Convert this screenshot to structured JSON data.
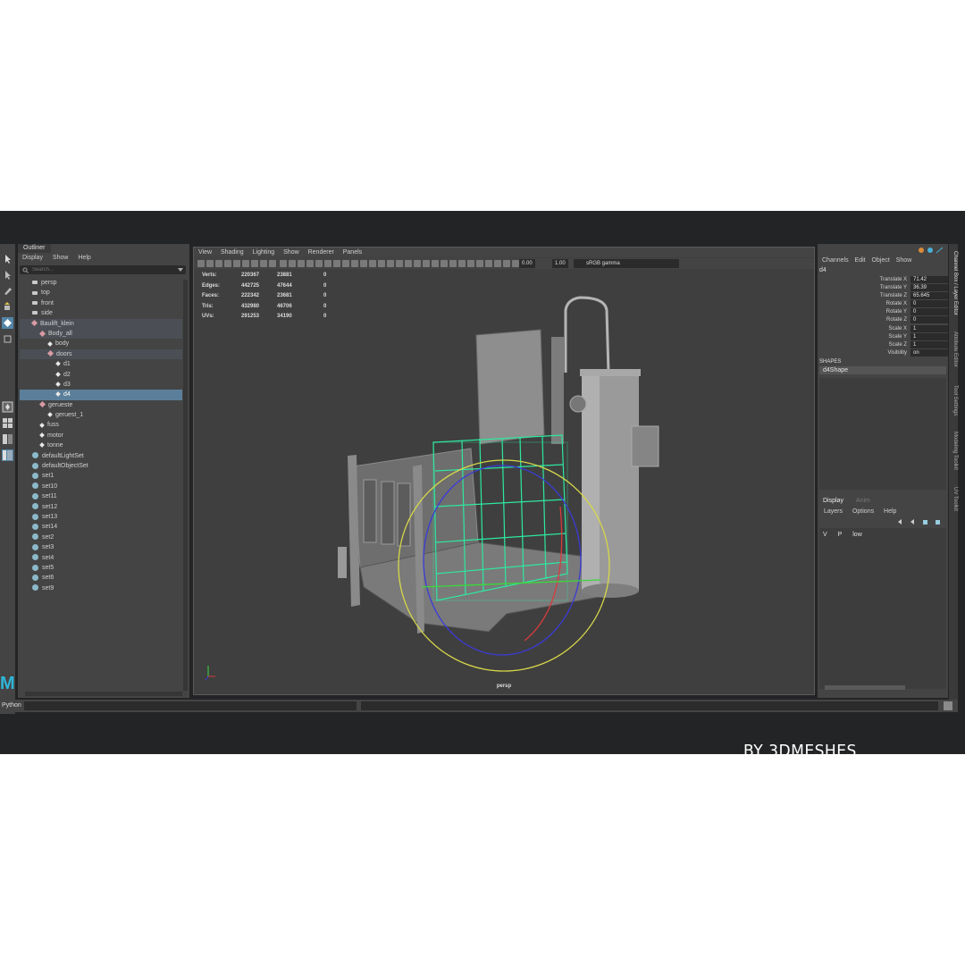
{
  "outliner": {
    "tab": "Outliner",
    "menu": [
      "Display",
      "Show",
      "Help"
    ],
    "search_placeholder": "Search...",
    "items": [
      {
        "label": "persp",
        "indent": 0,
        "type": "cam"
      },
      {
        "label": "top",
        "indent": 0,
        "type": "cam"
      },
      {
        "label": "front",
        "indent": 0,
        "type": "cam"
      },
      {
        "label": "side",
        "indent": 0,
        "type": "cam"
      },
      {
        "label": "Baulift_klein",
        "indent": 0,
        "type": "grp",
        "state": "hl"
      },
      {
        "label": "Body_all",
        "indent": 1,
        "type": "grp",
        "state": "hl"
      },
      {
        "label": "body",
        "indent": 2,
        "type": "mesh"
      },
      {
        "label": "doors",
        "indent": 2,
        "type": "grp",
        "state": "hl"
      },
      {
        "label": "d1",
        "indent": 3,
        "type": "mesh"
      },
      {
        "label": "d2",
        "indent": 3,
        "type": "mesh"
      },
      {
        "label": "d3",
        "indent": 3,
        "type": "mesh"
      },
      {
        "label": "d4",
        "indent": 3,
        "type": "mesh",
        "state": "sel"
      },
      {
        "label": "gerueste",
        "indent": 1,
        "type": "grp"
      },
      {
        "label": "geruest_1",
        "indent": 2,
        "type": "mesh"
      },
      {
        "label": "fuss",
        "indent": 1,
        "type": "mesh"
      },
      {
        "label": "motor",
        "indent": 1,
        "type": "mesh"
      },
      {
        "label": "tonne",
        "indent": 1,
        "type": "mesh"
      },
      {
        "label": "defaultLightSet",
        "indent": 0,
        "type": "set"
      },
      {
        "label": "defaultObjectSet",
        "indent": 0,
        "type": "set"
      },
      {
        "label": "set1",
        "indent": 0,
        "type": "set"
      },
      {
        "label": "set10",
        "indent": 0,
        "type": "set"
      },
      {
        "label": "set11",
        "indent": 0,
        "type": "set"
      },
      {
        "label": "set12",
        "indent": 0,
        "type": "set"
      },
      {
        "label": "set13",
        "indent": 0,
        "type": "set"
      },
      {
        "label": "set14",
        "indent": 0,
        "type": "set"
      },
      {
        "label": "set2",
        "indent": 0,
        "type": "set"
      },
      {
        "label": "set3",
        "indent": 0,
        "type": "set"
      },
      {
        "label": "set4",
        "indent": 0,
        "type": "set"
      },
      {
        "label": "set5",
        "indent": 0,
        "type": "set"
      },
      {
        "label": "set6",
        "indent": 0,
        "type": "set"
      },
      {
        "label": "set9",
        "indent": 0,
        "type": "set"
      }
    ]
  },
  "viewport": {
    "menu": [
      "View",
      "Shading",
      "Lighting",
      "Show",
      "Renderer",
      "Panels"
    ],
    "exposure": "0.00",
    "gamma": "1.00",
    "colorspace": "sRGB gamma",
    "hud": [
      {
        "k": "Verts:",
        "v1": "220367",
        "v2": "23881",
        "v3": "0"
      },
      {
        "k": "Edges:",
        "v1": "442725",
        "v2": "47644",
        "v3": "0"
      },
      {
        "k": "Faces:",
        "v1": "222342",
        "v2": "23681",
        "v3": "0"
      },
      {
        "k": "Tris:",
        "v1": "432980",
        "v2": "46706",
        "v3": "0"
      },
      {
        "k": "UVs:",
        "v1": "291253",
        "v2": "34190",
        "v3": "0"
      }
    ],
    "camera": "persp"
  },
  "channels": {
    "menu": [
      "Channels",
      "Edit",
      "Object",
      "Show"
    ],
    "object": "d4",
    "attrs": [
      {
        "name": "Translate X",
        "value": "71.42"
      },
      {
        "name": "Translate Y",
        "value": "36.39"
      },
      {
        "name": "Translate Z",
        "value": "65.645"
      },
      {
        "name": "Rotate X",
        "value": "0"
      },
      {
        "name": "Rotate Y",
        "value": "0"
      },
      {
        "name": "Rotate Z",
        "value": "0"
      },
      {
        "name": "Scale X",
        "value": "1"
      },
      {
        "name": "Scale Y",
        "value": "1"
      },
      {
        "name": "Scale Z",
        "value": "1"
      },
      {
        "name": "Visibility",
        "value": "on"
      }
    ],
    "shapes_header": "SHAPES",
    "shape": "d4Shape",
    "layer_tabs": [
      "Display",
      "Anim"
    ],
    "layer_menu": [
      "Layers",
      "Options",
      "Help"
    ],
    "layer": {
      "v": "V",
      "p": "P",
      "name": "low"
    }
  },
  "side_tabs": [
    "Channel Box / Layer Editor",
    "Attribute Editor",
    "Tool Settings",
    "Modeling Toolkit",
    "UV Toolkit"
  ],
  "command": {
    "label": "Python"
  },
  "watermark": "BY 3DMESHES",
  "colors": {
    "accent": "#5b7f9a",
    "wireframe": "#2ee8a0",
    "manip_yellow": "#d8d84a"
  }
}
